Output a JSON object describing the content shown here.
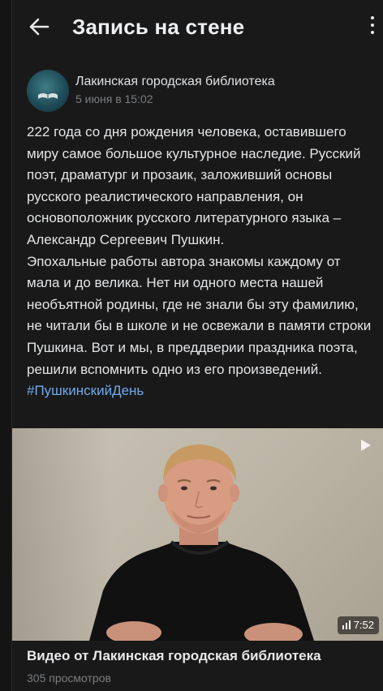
{
  "header": {
    "title": "Запись на стене",
    "back_icon": "arrow-left-icon",
    "more_icon": "more-vertical-icon"
  },
  "post": {
    "author": "Лакинская городская библиотека",
    "date": "5 июня в 15:02",
    "paragraph1": "222 года со дня рождения человека, оставившего миру самое большое культурное наследие. Русский поэт, драматург и прозаик, заложивший основы русского реалистического направления, он основоположник русского литературного языка – Александр Сергеевич Пушкин.",
    "paragraph2": "Эпохальные работы автора знакомы каждому от мала и до велика. Нет ни одного места нашей необъятной родины, где не знали бы эту фамилию, не читали бы в школе и не освежали в памяти строки Пушкина. Вот и мы, в преддверии праздника поэта, решили вспомнить одно из его произведений.",
    "hashtag": "#ПушкинскийДень"
  },
  "video": {
    "duration": "7:52",
    "title": "Видео от Лакинская городская библиотека",
    "views": "305 просмотров"
  },
  "colors": {
    "background": "#191919",
    "link": "#71aaeb",
    "secondary_text": "#7b7d80"
  }
}
